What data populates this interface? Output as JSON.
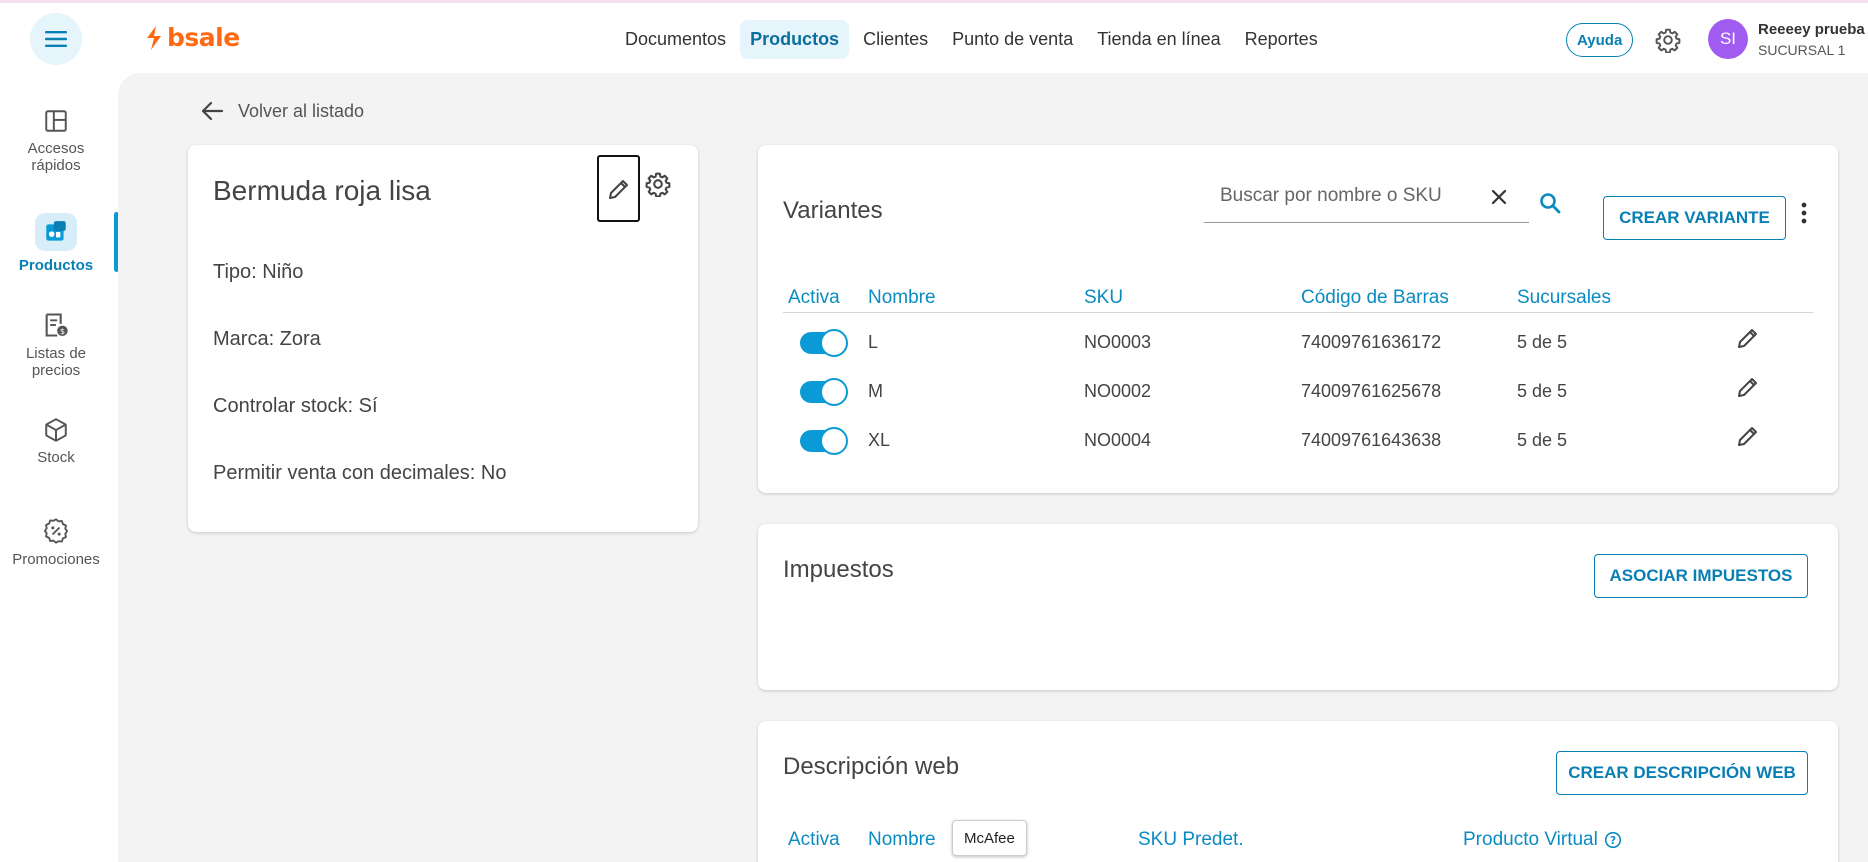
{
  "header": {
    "brand": "bsale",
    "nav": [
      {
        "label": "Documentos",
        "active": false
      },
      {
        "label": "Productos",
        "active": true
      },
      {
        "label": "Clientes",
        "active": false
      },
      {
        "label": "Punto de venta",
        "active": false
      },
      {
        "label": "Tienda en línea",
        "active": false
      },
      {
        "label": "Reportes",
        "active": false
      }
    ],
    "help_label": "Ayuda",
    "avatar_initials": "SI",
    "user_name": "Reeeey prueba",
    "user_branch": "SUCURSAL 1"
  },
  "sidebar": {
    "items": [
      {
        "label_line1": "Accesos",
        "label_line2": "rápidos",
        "icon": "dashboard-icon",
        "active": false
      },
      {
        "label_line1": "Productos",
        "label_line2": "",
        "icon": "products-icon",
        "active": true
      },
      {
        "label_line1": "Listas de",
        "label_line2": "precios",
        "icon": "price-list-icon",
        "active": false
      },
      {
        "label_line1": "Stock",
        "label_line2": "",
        "icon": "box-icon",
        "active": false
      },
      {
        "label_line1": "Promociones",
        "label_line2": "",
        "icon": "discount-icon",
        "active": false
      }
    ]
  },
  "back_label": "Volver al listado",
  "product": {
    "title": "Bermuda roja lisa",
    "attributes": [
      "Tipo: Niño",
      "Marca: Zora",
      "Controlar stock: Sí",
      "Permitir venta con decimales: No"
    ]
  },
  "variants": {
    "title": "Variantes",
    "search_placeholder": "Buscar por nombre o SKU",
    "create_label": "CREAR VARIANTE",
    "columns": [
      "Activa",
      "Nombre",
      "SKU",
      "Código de Barras",
      "Sucursales"
    ],
    "rows": [
      {
        "active": true,
        "name": "L",
        "sku": "NO0003",
        "barcode": "74009761636172",
        "branches": "5 de 5"
      },
      {
        "active": true,
        "name": "M",
        "sku": "NO0002",
        "barcode": "74009761625678",
        "branches": "5 de 5"
      },
      {
        "active": true,
        "name": "XL",
        "sku": "NO0004",
        "barcode": "74009761643638",
        "branches": "5 de 5"
      }
    ]
  },
  "taxes": {
    "title": "Impuestos",
    "associate_label": "ASOCIAR IMPUESTOS"
  },
  "web_description": {
    "title": "Descripción web",
    "create_label": "CREAR DESCRIPCIÓN WEB",
    "columns": [
      "Activa",
      "Nombre",
      "SKU Predet.",
      "Producto Virtual"
    ]
  },
  "tooltip": "McAfee",
  "colors": {
    "accent": "#0a7fb3",
    "brand": "#ff6a13",
    "avatar": "#a05cf0"
  }
}
